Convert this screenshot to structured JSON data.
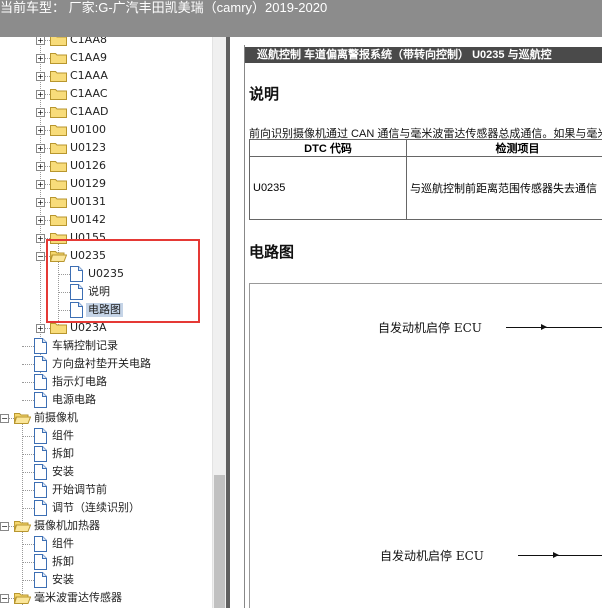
{
  "topbar": {
    "title": "当前车型： 厂家:G-广汽丰田凯美瑞（camry）2019-2020"
  },
  "tree": {
    "items": [
      {
        "label": "C1AA8",
        "type": "folder",
        "level": 2
      },
      {
        "label": "C1AA9",
        "type": "folder",
        "level": 2
      },
      {
        "label": "C1AAA",
        "type": "folder",
        "level": 2
      },
      {
        "label": "C1AAC",
        "type": "folder",
        "level": 2
      },
      {
        "label": "C1AAD",
        "type": "folder",
        "level": 2
      },
      {
        "label": "U0100",
        "type": "folder",
        "level": 2
      },
      {
        "label": "U0123",
        "type": "folder",
        "level": 2
      },
      {
        "label": "U0126",
        "type": "folder",
        "level": 2
      },
      {
        "label": "U0129",
        "type": "folder",
        "level": 2
      },
      {
        "label": "U0131",
        "type": "folder",
        "level": 2
      },
      {
        "label": "U0142",
        "type": "folder",
        "level": 2
      },
      {
        "label": "U0155",
        "type": "folder",
        "level": 2
      },
      {
        "label": "U0235",
        "type": "folder-open",
        "level": 2
      },
      {
        "label": "U0235",
        "type": "doc",
        "level": 3
      },
      {
        "label": "说明",
        "type": "doc",
        "level": 3
      },
      {
        "label": "电路图",
        "type": "doc",
        "level": 3,
        "selected": true
      },
      {
        "label": "U023A",
        "type": "folder",
        "level": 2
      },
      {
        "label": "车辆控制记录",
        "type": "doc",
        "level": 1
      },
      {
        "label": "方向盘衬垫开关电路",
        "type": "doc",
        "level": 1
      },
      {
        "label": "指示灯电路",
        "type": "doc",
        "level": 1
      },
      {
        "label": "电源电路",
        "type": "doc",
        "level": 1
      },
      {
        "label": "前摄像机",
        "type": "folder-open",
        "level": 0
      },
      {
        "label": "组件",
        "type": "doc",
        "level": 1
      },
      {
        "label": "拆卸",
        "type": "doc",
        "level": 1
      },
      {
        "label": "安装",
        "type": "doc",
        "level": 1
      },
      {
        "label": "开始调节前",
        "type": "doc",
        "level": 1
      },
      {
        "label": "调节（连续识别）",
        "type": "doc",
        "level": 1
      },
      {
        "label": "摄像机加热器",
        "type": "folder-open",
        "level": 0
      },
      {
        "label": "组件",
        "type": "doc",
        "level": 1
      },
      {
        "label": "拆卸",
        "type": "doc",
        "level": 1
      },
      {
        "label": "安装",
        "type": "doc",
        "level": 1
      },
      {
        "label": "毫米波雷达传感器",
        "type": "folder-open",
        "level": 0
      }
    ]
  },
  "doc": {
    "header": "巡航控制  车道偏离警报系统（带转向控制）  U0235  与巡航控",
    "section1_title": "说明",
    "desc_text": "前向识别摄像机通过 CAN 通信与毫米波雷达传感器总成通信。如果与毫米",
    "table": {
      "headers": [
        "DTC 代码",
        "检测项目"
      ],
      "rows": [
        [
          "U0235",
          "与巡航控制前距离范围传感器失去通信"
        ]
      ]
    },
    "section2_title": "电路图",
    "circuit_labels": [
      "自发动机启停 ECU",
      "自发动机启停 ECU"
    ]
  },
  "colors": {
    "topbar": "#8c8c8c",
    "highlight": "#e53935",
    "selection": "#c5d4e7"
  }
}
